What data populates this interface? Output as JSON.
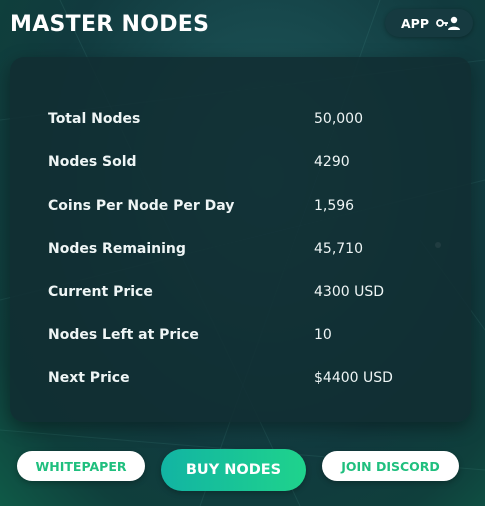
{
  "header": {
    "title": "MASTER NODES",
    "app_button_label": "APP"
  },
  "stats": [
    {
      "label": "Total Nodes",
      "value": "50,000"
    },
    {
      "label": "Nodes Sold",
      "value": "4290"
    },
    {
      "label": "Coins Per Node Per Day",
      "value": "1,596"
    },
    {
      "label": "Nodes Remaining",
      "value": "45,710"
    },
    {
      "label": "Current Price",
      "value": "4300 USD"
    },
    {
      "label": "Nodes Left at Price",
      "value": "10"
    },
    {
      "label": "Next Price",
      "value": "$4400 USD"
    }
  ],
  "actions": {
    "whitepaper": "WHITEPAPER",
    "buy_nodes": "BUY NODES",
    "join_discord": "JOIN DISCORD"
  },
  "icons": {
    "app": "user-key-icon"
  },
  "colors": {
    "accent_green": "#1fd38c",
    "accent_teal": "#12b4a3",
    "card_bg": "#112d32",
    "text": "#eef5f5"
  }
}
